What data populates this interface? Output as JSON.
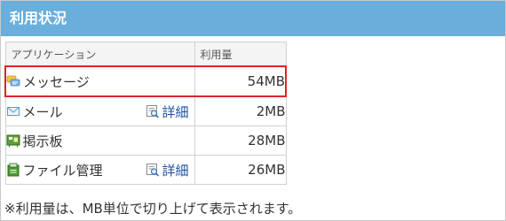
{
  "panel": {
    "title": "利用状況"
  },
  "table": {
    "headers": {
      "application": "アプリケーション",
      "usage": "利用量"
    },
    "rows": [
      {
        "name": "メッセージ",
        "size": "54MB",
        "icon": "message-icon",
        "detail": ""
      },
      {
        "name": "メール",
        "size": "2MB",
        "icon": "mail-icon",
        "detail": "詳細"
      },
      {
        "name": "掲示板",
        "size": "28MB",
        "icon": "bulletin-board-icon",
        "detail": ""
      },
      {
        "name": "ファイル管理",
        "size": "26MB",
        "icon": "file-management-icon",
        "detail": "詳細"
      }
    ]
  },
  "note": "※利用量は、MB単位で切り上げて表示されます。",
  "colors": {
    "header_bg": "#6aaedc",
    "highlight_border": "#e0242a",
    "link": "#1e4f9a"
  }
}
